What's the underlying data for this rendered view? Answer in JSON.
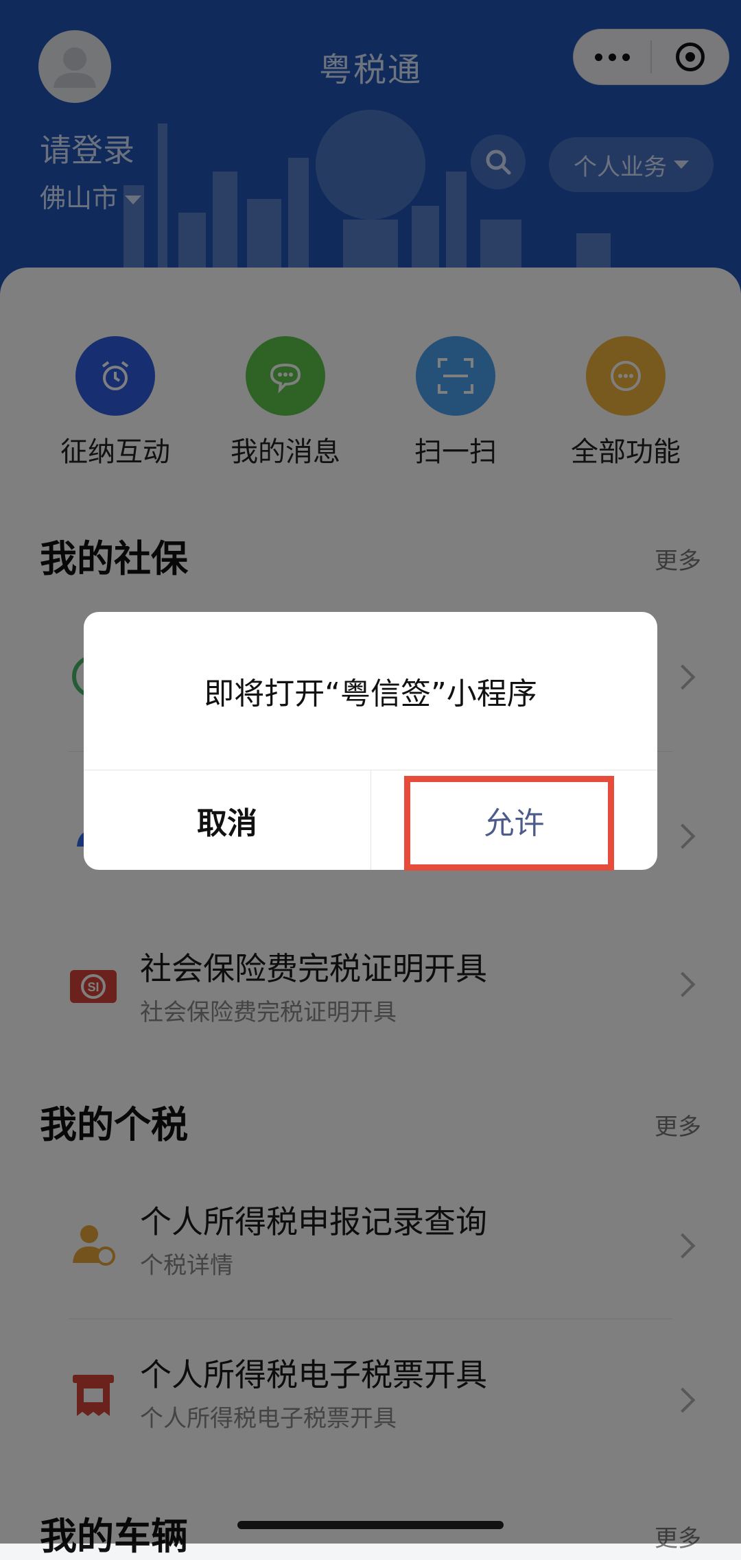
{
  "app": {
    "title": "粤税通"
  },
  "user": {
    "login_prompt": "请登录",
    "city": "佛山市"
  },
  "header": {
    "business_menu": "个人业务"
  },
  "colors": {
    "header_bg": "#1f55b6",
    "highlight_border": "#e64b3c",
    "allow_text": "#4c5b8a"
  },
  "quick_actions": [
    {
      "label": "征纳互动",
      "icon": "alarm-clock-icon",
      "color": "#2e5fe0"
    },
    {
      "label": "我的消息",
      "icon": "chat-bubble-icon",
      "color": "#5cc64a"
    },
    {
      "label": "扫一扫",
      "icon": "scan-icon",
      "color": "#4aa3f0"
    },
    {
      "label": "全部功能",
      "icon": "more-circle-icon",
      "color": "#f3b53c"
    }
  ],
  "social_insurance": {
    "title": "我的社保",
    "more": "更多",
    "items": [
      {
        "title": "社会保险费完税证明开具",
        "subtitle": "社会保险费完税证明开具",
        "icon": "social-security-card-icon"
      }
    ]
  },
  "personal_tax": {
    "title": "我的个税",
    "more": "更多",
    "items": [
      {
        "title": "个人所得税申报记录查询",
        "subtitle": "个税详情",
        "icon": "person-query-icon"
      },
      {
        "title": "个人所得税电子税票开具",
        "subtitle": "个人所得税电子税票开具",
        "icon": "tax-receipt-icon"
      }
    ]
  },
  "vehicle": {
    "title": "我的车辆",
    "more": "更多"
  },
  "dialog": {
    "message": "即将打开“粤信签”小程序",
    "cancel": "取消",
    "allow": "允许"
  }
}
